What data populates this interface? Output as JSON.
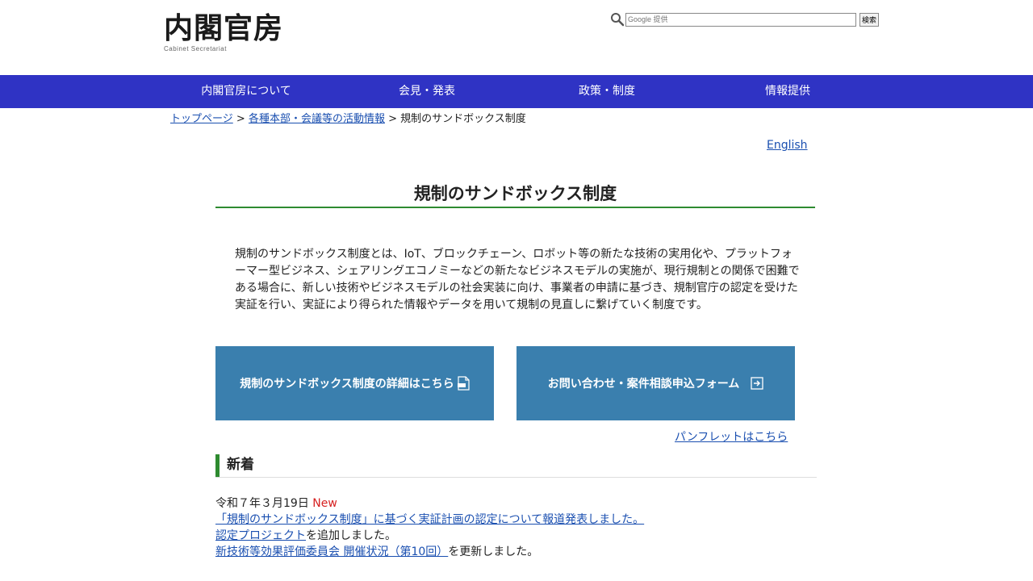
{
  "header": {
    "logo_text": "内閣官房",
    "logo_sub": "Cabinet Secretariat",
    "search_placeholder": "Google 提供",
    "search_button": "検索"
  },
  "nav": {
    "items": [
      {
        "label": "内閣官房について"
      },
      {
        "label": "会見・発表"
      },
      {
        "label": "政策・制度"
      },
      {
        "label": "情報提供"
      }
    ]
  },
  "breadcrumb": {
    "home": "トップページ",
    "sep": ">",
    "parent": "各種本部・会議等の活動情報",
    "current": "規制のサンドボックス制度"
  },
  "language_link": "English",
  "page_title": "規制のサンドボックス制度",
  "intro": "規制のサンドボックス制度とは、IoT、ブロックチェーン、ロボット等の新たな技術の実用化や、プラットフォーマー型ビジネス、シェアリングエコノミーなどの新たなビジネスモデルの実施が、現行規制との関係で困難である場合に、新しい技術やビジネスモデルの社会実装に向け、事業者の申請に基づき、規制官庁の認定を受けた実証を行い、実証により得られた情報やデータを用いて規制の見直しに繋げていく制度です。",
  "cta": {
    "details": "規制のサンドボックス制度の詳細はこちら",
    "contact": "お問い合わせ・案件相談申込フォーム"
  },
  "pamphlet_link": "パンフレットはこちら",
  "news": {
    "heading": "新着",
    "date": "令和７年３月19日",
    "new_label": "New",
    "item1_link": "「規制のサンドボックス制度」に基づく実証計画の認定について報道発表しました。",
    "item2_link": "認定プロジェクト",
    "item2_suffix": "を追加しました。",
    "item3_link": "新技術等効果評価委員会 開催状況（第10回）",
    "item3_suffix": "を更新しました。"
  },
  "colors": {
    "nav_bg": "#2f33c4",
    "cta_bg": "#3a7fae",
    "accent_green": "#2e8b30",
    "link": "#1a4fb0",
    "new_red": "#d62020"
  },
  "icons": [
    "search-icon",
    "pdf-icon",
    "external-arrow-icon"
  ]
}
